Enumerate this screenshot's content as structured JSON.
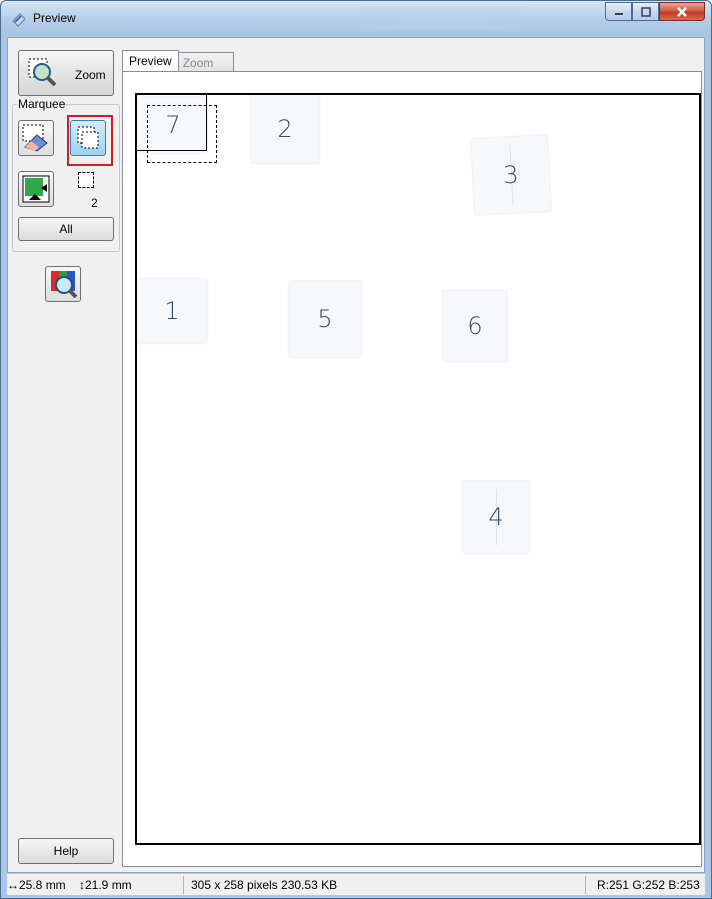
{
  "window": {
    "title": "Preview"
  },
  "toolbar": {
    "zoom_label": "Zoom",
    "marquee_group": "Marquee",
    "marquee_count": "2",
    "all_label": "All",
    "help_label": "Help"
  },
  "tabs": [
    {
      "label": "Preview",
      "active": true
    },
    {
      "label": "Zoom",
      "active": false
    }
  ],
  "preview": {
    "sheets": [
      {
        "label": "7"
      },
      {
        "label": "2"
      },
      {
        "label": "3"
      },
      {
        "label": "1"
      },
      {
        "label": "5"
      },
      {
        "label": "6"
      },
      {
        "label": "4"
      }
    ]
  },
  "status": {
    "width_text": "25.8 mm",
    "height_text": "21.9 mm",
    "size_text": "305 x 258 pixels 230.53 KB",
    "rgb_text": "R:251 G:252 B:253"
  },
  "colors": {
    "highlight": "#d11f2a",
    "active_button": "#9ed2f4",
    "close_button": "#c0392b"
  }
}
